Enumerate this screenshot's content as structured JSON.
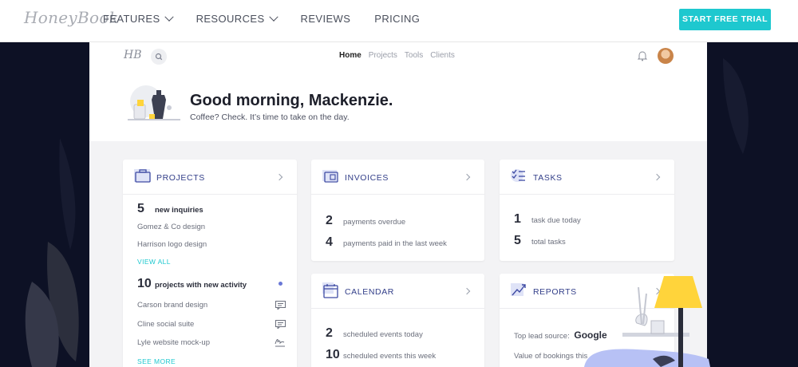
{
  "site": {
    "logo": "HoneyBook",
    "menu": [
      {
        "label": "FEATURES",
        "dropdown": true
      },
      {
        "label": "RESOURCES",
        "dropdown": true
      },
      {
        "label": "REVIEWS",
        "dropdown": false
      },
      {
        "label": "PRICING",
        "dropdown": false
      }
    ],
    "cta": "START FREE TRIAL",
    "accent": "#1ec8cf"
  },
  "app": {
    "logo": "HB",
    "tabs": [
      "Home",
      "Projects",
      "Tools",
      "Clients"
    ],
    "active_tab": "Home",
    "greeting": "Good morning, Mackenzie.",
    "subtext": "Coffee? Check. It’s time to take on the day."
  },
  "projects": {
    "title": "PROJECTS",
    "inquiries_count": "5",
    "inquiries_label": "new inquiries",
    "inquiries": [
      "Gomez & Co design",
      "Harrison logo design"
    ],
    "view_all": "VIEW ALL",
    "activity_count": "10",
    "activity_label": "projects with new activity",
    "activity": [
      {
        "name": "Carson brand design",
        "icon": "message-icon"
      },
      {
        "name": "Cline social suite",
        "icon": "message-icon"
      },
      {
        "name": "Lyle website mock-up",
        "icon": "signature-icon"
      }
    ],
    "see_more": "SEE MORE"
  },
  "invoices": {
    "title": "INVOICES",
    "rows": [
      {
        "num": "2",
        "label": "payments overdue"
      },
      {
        "num": "4",
        "label": "payments paid in the last week"
      }
    ]
  },
  "tasks": {
    "title": "TASKS",
    "rows": [
      {
        "num": "1",
        "label": "task due today"
      },
      {
        "num": "5",
        "label": "total tasks"
      }
    ]
  },
  "calendar": {
    "title": "CALENDAR",
    "rows": [
      {
        "num": "2",
        "label": "scheduled events today"
      },
      {
        "num": "10",
        "label": "scheduled events this week"
      }
    ]
  },
  "reports": {
    "title": "REPORTS",
    "lead_source_label": "Top lead source:",
    "lead_source_value": "Google",
    "bookings_label": "Value of bookings this"
  }
}
